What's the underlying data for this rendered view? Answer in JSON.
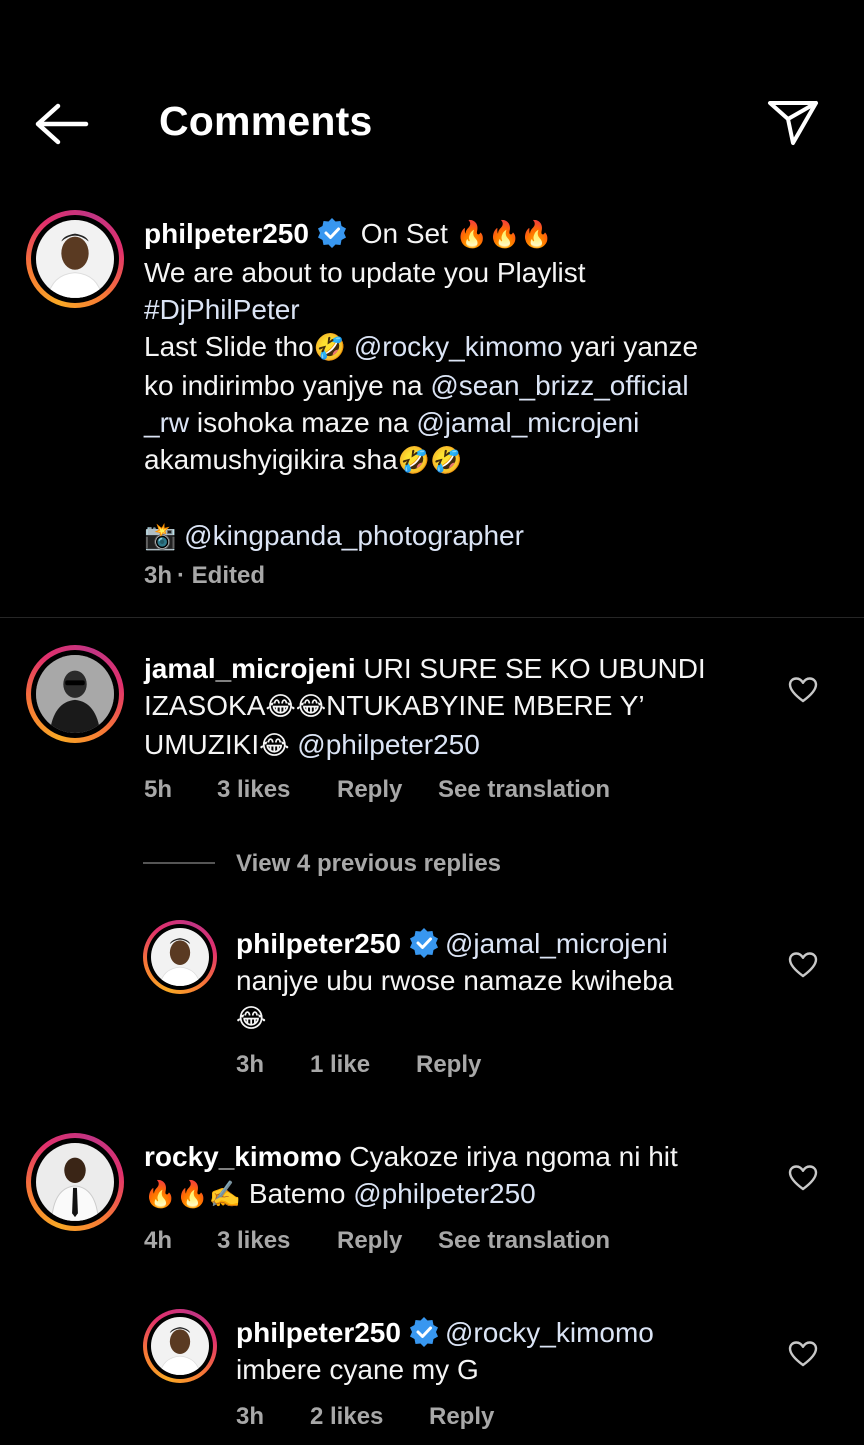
{
  "header": {
    "title": "Comments",
    "back_icon": "arrow-left-icon",
    "share_icon": "paper-plane-icon"
  },
  "post": {
    "username": "philpeter250",
    "verified": true,
    "line1_rest": " On Set ",
    "line1_emoji": "🔥🔥🔥",
    "line2": "We are about to update you Playlist",
    "hashtag": "#DjPhilPeter",
    "line4_a": "Last Slide tho",
    "line4_emoji": "🤣",
    "mention1": "@rocky_kimomo",
    "line4_b": " yari yanze",
    "line5_a": "ko indirimbo yanjye na ",
    "mention2": "@sean_brizz_official",
    "mention2b": "_rw",
    "line6_a": " isohoka maze na ",
    "mention3": "@jamal_microjeni",
    "line7": "akamushyigikira sha",
    "line7_emoji": "🤣🤣",
    "camera_emoji": "📸",
    "mention4": "@kingpanda_photographer",
    "time": "3h",
    "edited": " · Edited"
  },
  "comments": [
    {
      "username": "jamal_microjeni",
      "line1_rest": " URI SURE SE KO UBUNDI",
      "line2_a": "IZASOKA",
      "line2_emoji": "😂😂",
      "line2_b": "NTUKABYINE MBERE Y’",
      "line3_a": "UMUZIKI",
      "line3_emoji": "😂",
      "mention": "@philpeter250",
      "time": "5h",
      "likes": "3 likes",
      "reply": "Reply",
      "translate": "See translation"
    },
    {
      "username": "rocky_kimomo",
      "line1_rest": " Cyakoze iriya ngoma ni hit",
      "line2_emoji": "🔥🔥✍️",
      "line2_b": " Batemo ",
      "mention": "@philpeter250",
      "time": "4h",
      "likes": "3 likes",
      "reply": "Reply",
      "translate": "See translation"
    }
  ],
  "view_replies": "View 4 previous replies",
  "replies": [
    {
      "username": "philpeter250",
      "verified": true,
      "mention": "@jamal_microjeni",
      "line2": "nanjye ubu rwose namaze kwiheba",
      "line3_emoji": "😂",
      "time": "3h",
      "likes": "1 like",
      "reply": "Reply"
    },
    {
      "username": "philpeter250",
      "verified": true,
      "mention": "@rocky_kimomo",
      "line2": "imbere cyane my G",
      "time": "3h",
      "likes": "2 likes",
      "reply": "Reply"
    }
  ],
  "colors": {
    "background": "#000000",
    "text": "#f5f5f5",
    "secondary": "#a8a8a8",
    "mention": "#dbe4f5",
    "verified": "#3897f0"
  }
}
